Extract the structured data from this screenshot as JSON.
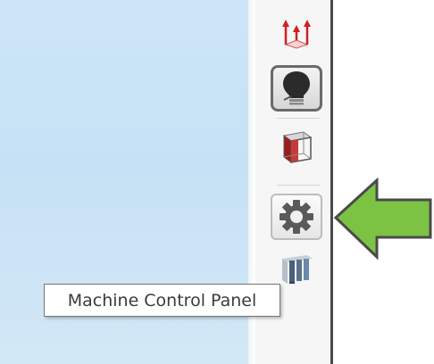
{
  "tooltip": {
    "text": "Machine Control Panel"
  },
  "toolbar": {
    "tools": [
      {
        "name": "axes",
        "icon": "axes-icon"
      },
      {
        "name": "lighting",
        "icon": "lightbulb-icon",
        "state": "active"
      },
      {
        "name": "bounding-box",
        "icon": "bounding-box-icon"
      },
      {
        "name": "machine-control-panel",
        "icon": "gear-icon",
        "state": "highlighted"
      },
      {
        "name": "fixtures",
        "icon": "columns-icon"
      }
    ]
  },
  "annotation": {
    "icon": "left-arrow-icon",
    "color": "#7cc243"
  },
  "colors": {
    "viewport": "#c9e3f6",
    "toolbar": "#f6f6f6",
    "active_border": "#6a6a6a"
  }
}
